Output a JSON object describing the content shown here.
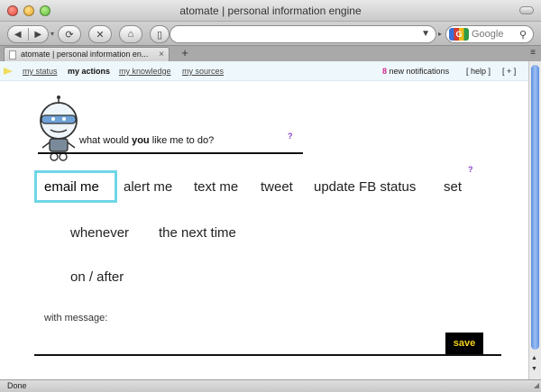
{
  "window": {
    "title": "atomate | personal information engine"
  },
  "browser": {
    "search_placeholder": "Google",
    "tab_title": "atomate | personal information en...",
    "new_tab_label": "+",
    "status_text": "Done"
  },
  "nav": {
    "links": {
      "my_status": "my status",
      "my_actions": "my actions",
      "my_knowledge": "my knowledge",
      "my_sources": "my sources"
    },
    "notification_count": "8",
    "notification_label": "new notifications",
    "help": "[ help ]",
    "plus": "[ + ]"
  },
  "prompt": {
    "before": "what would ",
    "bold": "you",
    "after": " like me to do?",
    "help_mark": "?"
  },
  "actions": {
    "selected": "email me",
    "options": [
      "alert me",
      "text me",
      "tweet",
      "update FB status",
      "set"
    ],
    "help_mark": "?"
  },
  "timing": {
    "options": [
      "whenever",
      "the next time",
      "on / after"
    ]
  },
  "message": {
    "label": "with message:",
    "value": ""
  },
  "save_label": "save",
  "colors": {
    "selection_border": "#6fd6e6",
    "save_bg": "#000000",
    "save_text": "#f2d21b",
    "notification_count": "#d0288a",
    "help_mark": "#8a40c8",
    "nav_bg": "#eef7fb"
  }
}
